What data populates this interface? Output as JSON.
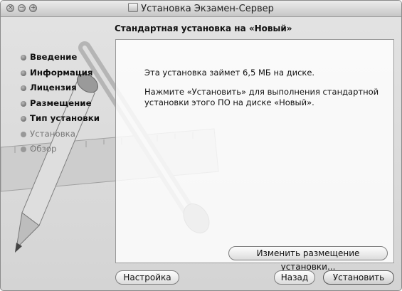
{
  "window": {
    "title": "Установка Экзамен-Сервер",
    "controls": {
      "close_glyph": "×",
      "minimize_glyph": "−",
      "zoom_glyph": "+"
    }
  },
  "header": {
    "subtitle": "Стандартная установка на «Новый»"
  },
  "sidebar": {
    "steps": [
      {
        "label": "Введение",
        "state": "done"
      },
      {
        "label": "Информация",
        "state": "done"
      },
      {
        "label": "Лицензия",
        "state": "done"
      },
      {
        "label": "Размещение",
        "state": "done"
      },
      {
        "label": "Тип установки",
        "state": "current"
      },
      {
        "label": "Установка",
        "state": "pending"
      },
      {
        "label": "Обзор",
        "state": "pending"
      }
    ]
  },
  "main": {
    "size_text": "Эта установка займет 6,5 МБ на диске.",
    "instructions": "Нажмите «Установить» для выполнения стандартной установки этого ПО на диске «Новый».",
    "change_location_label": "Изменить размещение установки..."
  },
  "footer": {
    "customize_label": "Настройка",
    "back_label": "Назад",
    "install_label": "Установить"
  }
}
